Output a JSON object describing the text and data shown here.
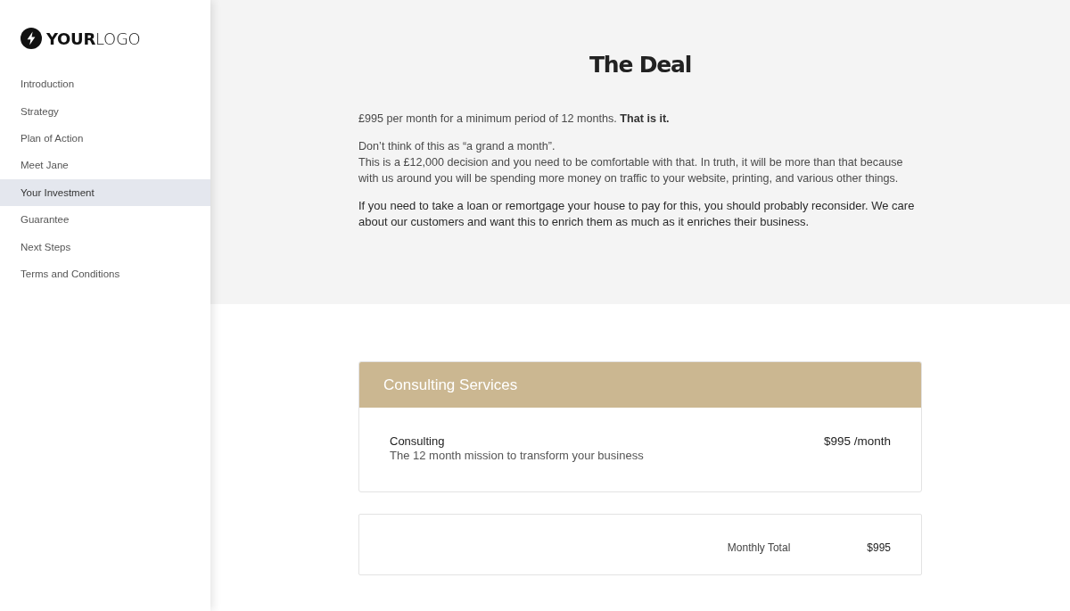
{
  "logo": {
    "text": "**YOUR**LOGO"
  },
  "sidebar": {
    "items": [
      {
        "label": "Introduction",
        "selected": false
      },
      {
        "label": "Strategy",
        "selected": false
      },
      {
        "label": "Plan of Action",
        "selected": false
      },
      {
        "label": "Meet Jane",
        "selected": false
      },
      {
        "label": "Your Investment",
        "selected": true
      },
      {
        "label": "Guarantee",
        "selected": false
      },
      {
        "label": "Next Steps",
        "selected": false
      },
      {
        "label": "Terms and Conditions",
        "selected": false
      }
    ]
  },
  "hero": {
    "title": "The Deal",
    "paragraphs": [
      {
        "kind": "plain",
        "lines": [
          "£995 per month for a minimum period of 12 months. **That is it.**"
        ]
      },
      {
        "kind": "plain",
        "lines": [
          "Don’t think of this as “a grand a month”.",
          "This is a £12,000 decision and you need to be comfortable with that. In truth, it will be more than that because with us around you will be spending more money on traffic to your website, printing, and various other things."
        ]
      },
      {
        "kind": "emphasis",
        "lines": [
          "If you need to take a loan or remortgage your house to pay for this, you should probably reconsider. We care about our customers and want this to enrich them as much as it enriches their business."
        ]
      }
    ]
  },
  "pricing_table": {
    "title": "Consulting Services",
    "items": [
      {
        "name": "Consulting",
        "description": "The 12 month mission to transform your business",
        "price": "$995 /month"
      }
    ]
  },
  "total": {
    "label": "Monthly Total",
    "value": "$995"
  }
}
